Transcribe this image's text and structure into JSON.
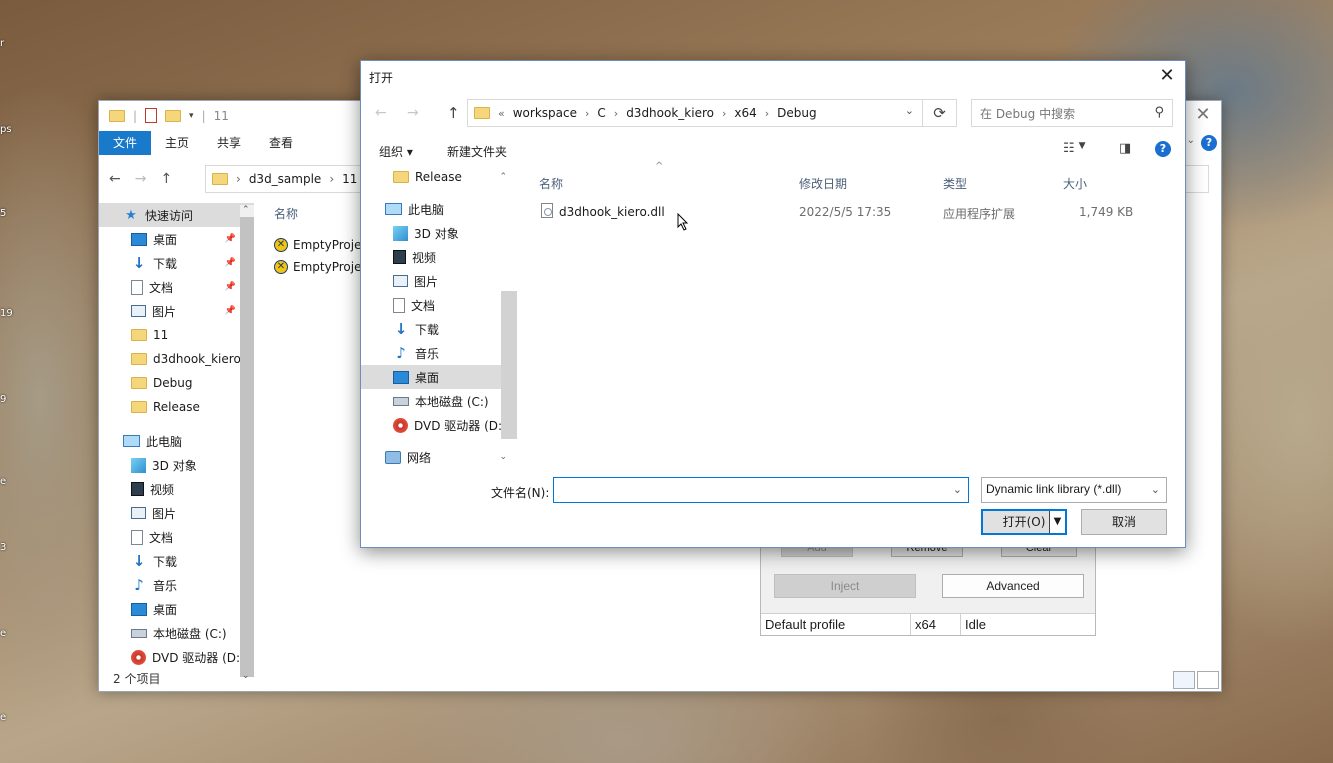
{
  "desktop": {
    "labels": [
      "r",
      "ps",
      "5",
      "19",
      "9",
      "e",
      "3",
      "e",
      "e"
    ]
  },
  "explorer": {
    "title": "11",
    "ribbon_tabs": [
      "文件",
      "主页",
      "共享",
      "查看"
    ],
    "breadcrumb": [
      "d3d_sample",
      "11"
    ],
    "sidebar": [
      {
        "label": "快速访问",
        "icon": "star-icon",
        "indent": 0,
        "selected": true,
        "pinned": false
      },
      {
        "label": "桌面",
        "icon": "desktop-icon",
        "indent": 1,
        "pinned": true
      },
      {
        "label": "下载",
        "icon": "download-icon",
        "indent": 1,
        "pinned": true
      },
      {
        "label": "文档",
        "icon": "document-icon",
        "indent": 1,
        "pinned": true
      },
      {
        "label": "图片",
        "icon": "pictures-icon",
        "indent": 1,
        "pinned": true
      },
      {
        "label": "11",
        "icon": "folder-icon",
        "indent": 1,
        "pinned": false
      },
      {
        "label": "d3dhook_kiero",
        "icon": "folder-icon",
        "indent": 1,
        "pinned": false
      },
      {
        "label": "Debug",
        "icon": "folder-icon",
        "indent": 1,
        "pinned": false
      },
      {
        "label": "Release",
        "icon": "folder-icon",
        "indent": 1,
        "pinned": false
      },
      {
        "label": "",
        "icon": "",
        "indent": 0,
        "spacer": true
      },
      {
        "label": "此电脑",
        "icon": "pc-icon",
        "indent": 0,
        "pinned": false
      },
      {
        "label": "3D 对象",
        "icon": "3d-objects-icon",
        "indent": 1,
        "pinned": false
      },
      {
        "label": "视频",
        "icon": "video-icon",
        "indent": 1,
        "pinned": false
      },
      {
        "label": "图片",
        "icon": "pictures-icon",
        "indent": 1,
        "pinned": false
      },
      {
        "label": "文档",
        "icon": "document-icon",
        "indent": 1,
        "pinned": false
      },
      {
        "label": "下载",
        "icon": "download-icon",
        "indent": 1,
        "pinned": false
      },
      {
        "label": "音乐",
        "icon": "music-icon",
        "indent": 1,
        "pinned": false
      },
      {
        "label": "桌面",
        "icon": "desktop-icon",
        "indent": 1,
        "pinned": false
      },
      {
        "label": "本地磁盘 (C:)",
        "icon": "drive-icon",
        "indent": 1,
        "pinned": false
      },
      {
        "label": "DVD 驱动器 (D:",
        "icon": "dvd-icon",
        "indent": 1,
        "pinned": false
      }
    ],
    "column_name": "名称",
    "files": [
      "EmptyProje",
      "EmptyProje"
    ],
    "status": "2 个项目"
  },
  "injector": {
    "add_label": "Add",
    "remove_label": "Remove",
    "clear_label": "Clear",
    "inject_label": "Inject",
    "advanced_label": "Advanced",
    "status": {
      "profile": "Default profile",
      "arch": "x64",
      "state": "Idle"
    }
  },
  "dialog": {
    "title": "打开",
    "path": [
      "workspace",
      "C",
      "d3dhook_kiero",
      "x64",
      "Debug"
    ],
    "search_placeholder": "在 Debug 中搜索",
    "organize_label": "组织 ▾",
    "new_folder_label": "新建文件夹",
    "tree": [
      {
        "label": "Release",
        "icon": "folder-icon",
        "indent": 1,
        "selected": false,
        "chev": "up"
      },
      {
        "label": "",
        "icon": "",
        "indent": 0,
        "spacer": true
      },
      {
        "label": "此电脑",
        "icon": "pc-icon",
        "indent": 0,
        "selected": false
      },
      {
        "label": "3D 对象",
        "icon": "3d-objects-icon",
        "indent": 1,
        "selected": false
      },
      {
        "label": "视频",
        "icon": "video-icon",
        "indent": 1,
        "selected": false
      },
      {
        "label": "图片",
        "icon": "pictures-icon",
        "indent": 1,
        "selected": false
      },
      {
        "label": "文档",
        "icon": "document-icon",
        "indent": 1,
        "selected": false
      },
      {
        "label": "下载",
        "icon": "download-icon",
        "indent": 1,
        "selected": false
      },
      {
        "label": "音乐",
        "icon": "music-icon",
        "indent": 1,
        "selected": false
      },
      {
        "label": "桌面",
        "icon": "desktop-icon",
        "indent": 1,
        "selected": true
      },
      {
        "label": "本地磁盘 (C:)",
        "icon": "drive-icon",
        "indent": 1,
        "selected": false
      },
      {
        "label": "DVD 驱动器 (D:",
        "icon": "dvd-icon",
        "indent": 1,
        "selected": false
      },
      {
        "label": "",
        "icon": "",
        "indent": 0,
        "spacer": true
      },
      {
        "label": "网络",
        "icon": "network-icon",
        "indent": 0,
        "selected": false,
        "chev": "down"
      }
    ],
    "columns": {
      "name": "名称",
      "date": "修改日期",
      "type": "类型",
      "size": "大小"
    },
    "files": [
      {
        "name": "d3dhook_kiero.dll",
        "date": "2022/5/5 17:35",
        "type": "应用程序扩展",
        "size": "1,749 KB"
      }
    ],
    "filename_label": "文件名(N):",
    "filename_value": "",
    "filetype": "Dynamic link library (*.dll)",
    "open_label": "打开(O)",
    "cancel_label": "取消"
  }
}
